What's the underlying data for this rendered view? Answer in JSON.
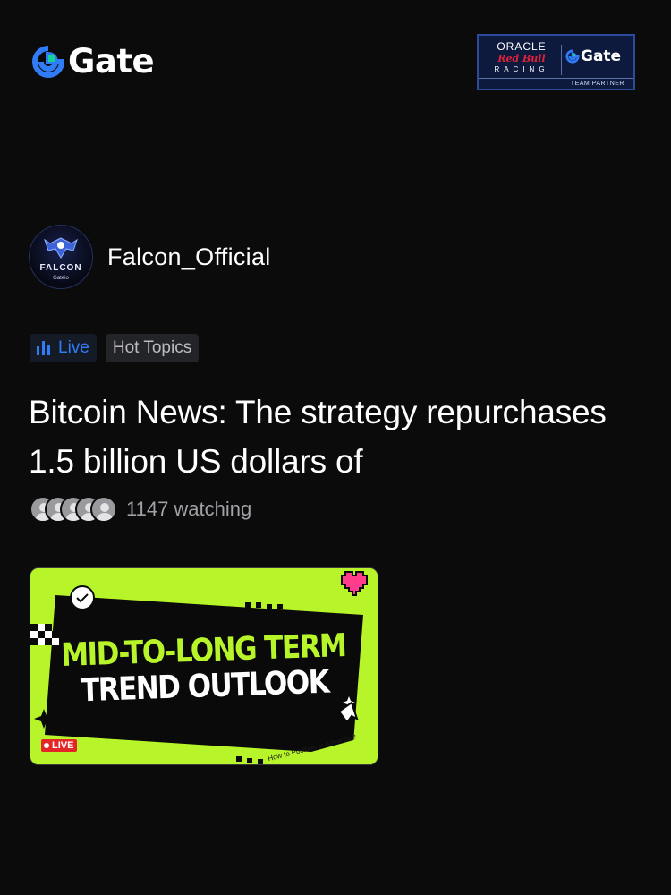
{
  "header": {
    "logo_text": "Gate",
    "partner": {
      "oracle": "ORACLE",
      "redbull": "Red Bull",
      "racing": "RACING",
      "gate": "Gate",
      "footer": "TEAM PARTNER"
    }
  },
  "author": {
    "avatar_name": "FALCON",
    "avatar_sub": "Gateio",
    "name": "Falcon_Official"
  },
  "tags": {
    "live": "Live",
    "topic": "Hot Topics"
  },
  "post": {
    "title": "Bitcoin News: The strategy repurchases 1.5 billion US dollars of",
    "watching": "1147 watching"
  },
  "thumbnail": {
    "line1": "MID-TO-LONG TERM",
    "line2": "TREND OUTLOOK",
    "live_badge": "LIVE",
    "question": "How to Position in Advance?"
  },
  "colors": {
    "background": "#0b0b0c",
    "accent_blue": "#2f7cf6",
    "thumb_green": "#b7f52a"
  }
}
